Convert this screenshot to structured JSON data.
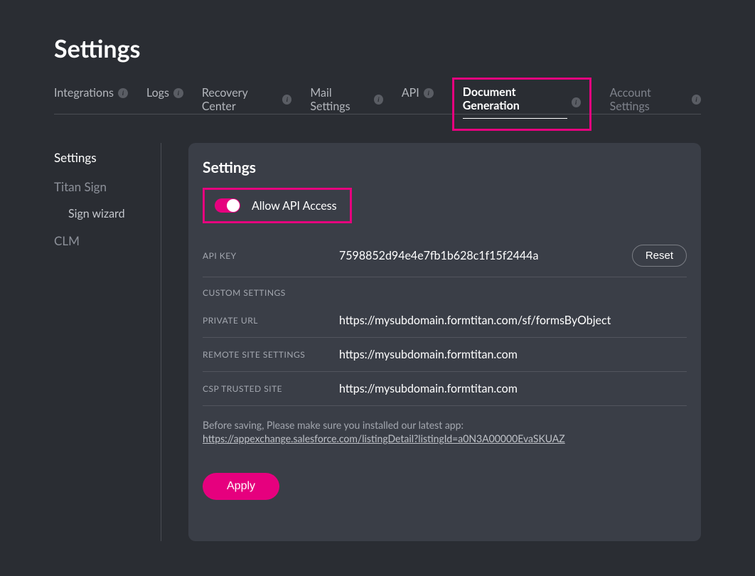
{
  "header": {
    "title": "Settings",
    "tabs": [
      {
        "label": "Integrations"
      },
      {
        "label": "Logs"
      },
      {
        "label": "Recovery Center"
      },
      {
        "label": "Mail Settings"
      },
      {
        "label": "API"
      },
      {
        "label": "Document Generation"
      },
      {
        "label": "Account Settings"
      }
    ]
  },
  "sidebar": {
    "items": [
      {
        "label": "Settings"
      },
      {
        "label": "Titan Sign"
      },
      {
        "label": "Sign wizard"
      },
      {
        "label": "CLM"
      }
    ]
  },
  "panel": {
    "title": "Settings",
    "toggle_label": "Allow API Access",
    "api_key_label": "API KEY",
    "api_key_value": "7598852d94e4e7fb1b628c1f15f2444a",
    "reset_label": "Reset",
    "custom_settings_label": "CUSTOM SETTINGS",
    "private_url_label": "PRIVATE URL",
    "private_url_value": "https://mysubdomain.formtitan.com/sf/formsByObject",
    "remote_site_label": "REMOTE SITE SETTINGS",
    "remote_site_value": "https://mysubdomain.formtitan.com",
    "csp_label": "CSP TRUSTED SITE",
    "csp_value": "https://mysubdomain.formtitan.com",
    "note_text": "Before saving, Please make sure you installed our latest app:",
    "note_link": "https://appexchange.salesforce.com/listingDetail?listingId=a0N3A00000EvaSKUAZ",
    "apply_label": "Apply"
  }
}
